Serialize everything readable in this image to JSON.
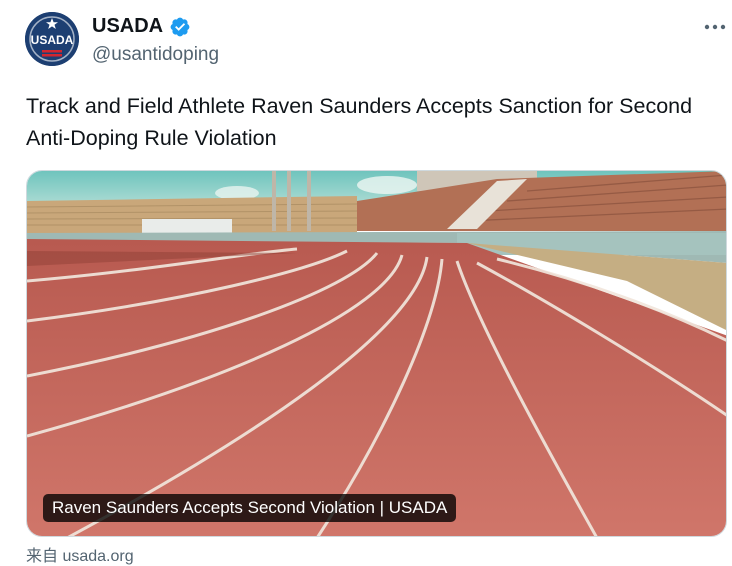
{
  "author": {
    "display_name": "USADA",
    "handle": "@usantidoping",
    "avatar_text": "USADA",
    "verified": true,
    "verified_color": "#1d9bf0"
  },
  "menu_icon": "more-horizontal-icon",
  "tweet": {
    "text": "Track and Field Athlete Raven Saunders Accepts Sanction for Second Anti-Doping Rule Violation"
  },
  "link_card": {
    "title": "Raven Saunders Accepts Second Violation | USADA",
    "source": "来自 usada.org"
  },
  "colors": {
    "brand_navy": "#1d3f72",
    "text_primary": "#0f1419",
    "text_secondary": "#536471",
    "track_red": "#c9665a"
  }
}
